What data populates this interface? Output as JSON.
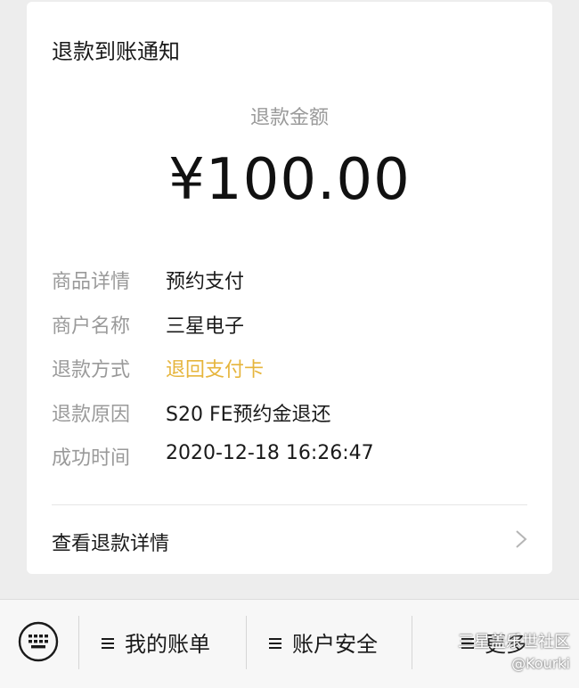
{
  "notice": {
    "title": "退款到账通知",
    "amount_label": "退款金额",
    "amount": "¥100.00",
    "rows": [
      {
        "key": "商品详情",
        "value": "预约支付"
      },
      {
        "key": "商户名称",
        "value": "三星电子"
      },
      {
        "key": "退款方式",
        "value": "退回支付卡"
      },
      {
        "key": "退款原因",
        "value": "S20 FE预约金退还"
      },
      {
        "key": "成功时间",
        "value": "2020-12-18 16:26:47"
      }
    ],
    "detail_link": "查看退款详情",
    "accent_color": "#e6b53c"
  },
  "bottom_bar": {
    "keyboard_icon": "keyboard-icon",
    "menus": [
      {
        "label": "我的账单"
      },
      {
        "label": "账户安全"
      },
      {
        "label": "更多"
      }
    ]
  },
  "watermark": {
    "text": "三星盖乐世社区",
    "handle": "@Kourki"
  }
}
